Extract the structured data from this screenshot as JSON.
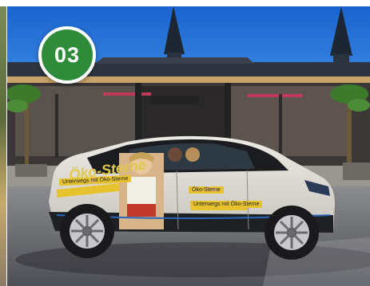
{
  "badge": {
    "number": "03",
    "color": "#2e8b3a"
  },
  "photo": {
    "car": {
      "brand_text": "Öko-Sterne",
      "slogan_left": "Unterwegs mit Öko-Sterne",
      "slogan_right": "Unterwegs mit Öko-Sterne",
      "small_logo": "Öko-Sterne"
    }
  },
  "colors": {
    "sky": "#1f6fd6",
    "car_body": "#d9d6cf",
    "wrap_yellow": "#e6c22e",
    "road": "#5b5d63"
  }
}
